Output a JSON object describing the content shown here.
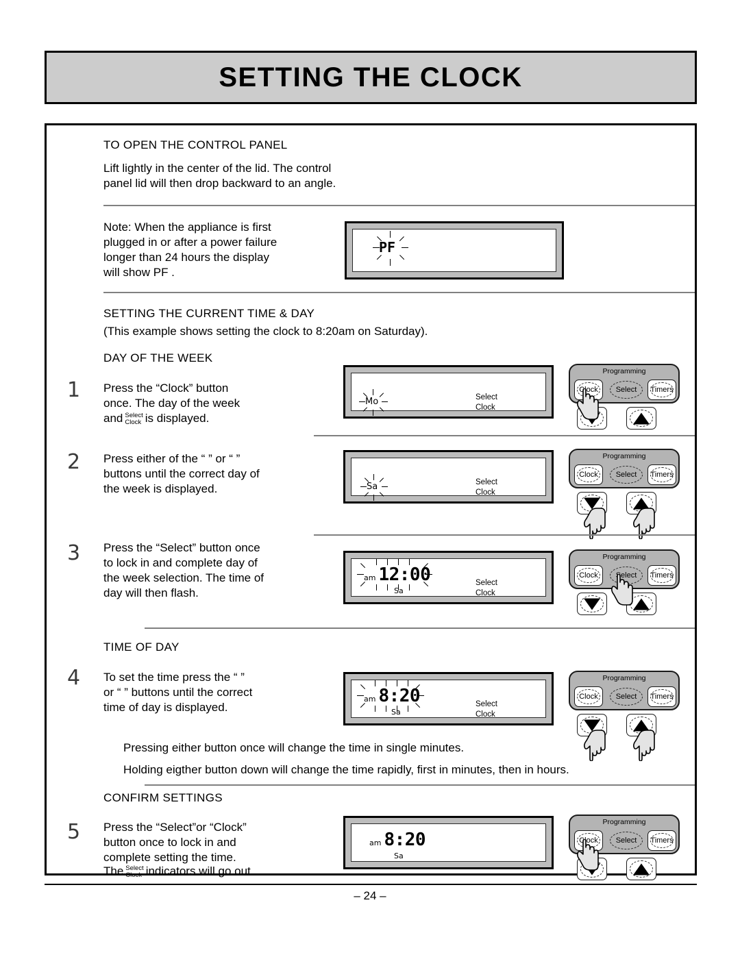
{
  "page": {
    "title": "SETTING THE CLOCK",
    "page_number": "– 24 –"
  },
  "sections": {
    "open_panel": {
      "heading": "TO OPEN THE CONTROL PANEL",
      "body_line1": "Lift lightly in the center of the lid. The control",
      "body_line2": "panel lid will then drop backward to an angle."
    },
    "note": {
      "line1": "Note: When the appliance is first",
      "line2": "plugged in or after a power failure",
      "line3": "longer than  24 hours the display",
      "line4": "will show  PF ."
    },
    "current_time_day": {
      "heading": "SETTING THE CURRENT TIME & DAY",
      "subheading": "(This example shows setting the clock to 8:20am on Saturday)."
    },
    "day_of_week": {
      "heading": "DAY OF THE WEEK"
    },
    "time_of_day": {
      "heading": "TIME OF DAY",
      "note1": "Pressing either button once will change the time in single minutes.",
      "note2": "Holding eigther button down will change the time rapidly, first in minutes, then in hours."
    },
    "confirm": {
      "heading": "CONFIRM SETTINGS"
    }
  },
  "steps": [
    {
      "number": "1",
      "line1": "Press the “Clock” button",
      "line2": "once. The day of the week",
      "line3_before": "and",
      "line3_after": "is displayed."
    },
    {
      "number": "2",
      "line1": "Press either of the “   ” or “   ”",
      "line2": "buttons until the correct day of",
      "line3": "the week is displayed."
    },
    {
      "number": "3",
      "line1": "Press the “Select” button once",
      "line2": "to lock in and complete day of",
      "line3": "the week selection. The time of",
      "line4": "day will then flash."
    },
    {
      "number": "4",
      "line1": "To set the time press the “   ”",
      "line2": "or “   ” buttons until the correct",
      "line3": "time of day is displayed."
    },
    {
      "number": "5",
      "line1": "Press the “Select”or “Clock”",
      "line2": "button once to lock in and",
      "line3": "complete setting the time.",
      "line4_before": "The",
      "line4_after": "indicators will go out."
    }
  ],
  "indicator_marker": {
    "top": "Select",
    "bottom": "Clock"
  },
  "displays": {
    "pf": {
      "text": "PF",
      "flashing": true
    },
    "step1": {
      "day": "Mo",
      "day_flashing": true,
      "indicator_select": "Select",
      "indicator_clock": "Clock"
    },
    "step2": {
      "day": "Sa",
      "day_flashing": true,
      "indicator_select": "Select",
      "indicator_clock": "Clock"
    },
    "step3": {
      "am": "am",
      "time": "12:00",
      "time_flashing": true,
      "day": "Sa",
      "indicator_select": "Select",
      "indicator_clock": "Clock"
    },
    "step4": {
      "am": "am",
      "time": "8:20",
      "time_flashing": true,
      "day": "Sa",
      "indicator_select": "Select",
      "indicator_clock": "Clock"
    },
    "step5": {
      "am": "am",
      "time": "8:20",
      "time_flashing": false,
      "day": "Sa",
      "indicator_select": "",
      "indicator_clock": ""
    }
  },
  "control_panel": {
    "group_label": "Programming",
    "buttons": {
      "clock": "Clock",
      "select": "Select",
      "timers": "Timers"
    },
    "arrows": {
      "down": "down-arrow",
      "up": "up-arrow"
    }
  },
  "colors": {
    "title_bar_bg": "#cccccc",
    "panel_grey": "#b4b4b4",
    "bezel_grey": "#bdbdbd",
    "rule_grey": "#808080",
    "ink": "#000000"
  }
}
